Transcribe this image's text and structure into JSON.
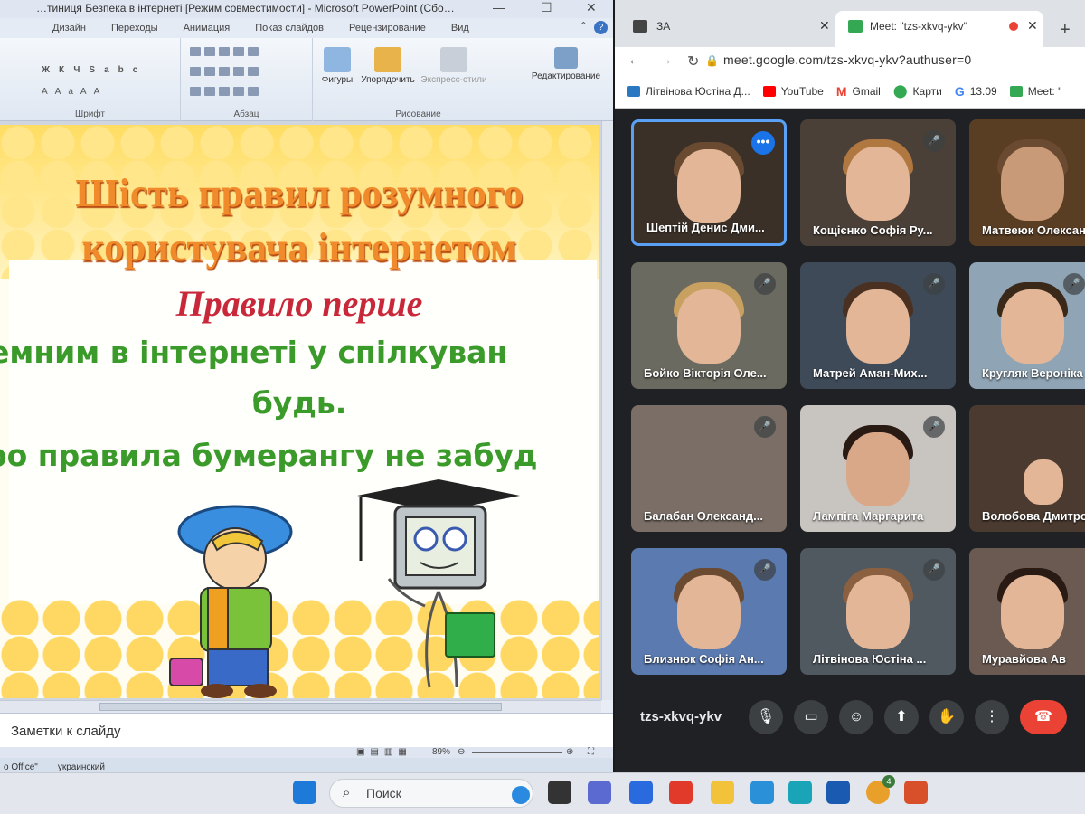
{
  "powerpoint": {
    "window_title": "…тиниця Безпека в інтернеті [Режим совместимости] - Microsoft PowerPoint (Сбо…",
    "tabs": [
      "Дизайн",
      "Переходы",
      "Анимация",
      "Показ слайдов",
      "Рецензирование",
      "Вид"
    ],
    "ribbon": {
      "groups": [
        "Шрифт",
        "Абзац",
        "Рисование"
      ],
      "shapes_label": "Фигуры",
      "arrange_label": "Упорядочить",
      "quick_styles_label": "Экспресс-стили",
      "editing_label": "Редактирование"
    },
    "slide": {
      "title_line1": "Шість правил розумного",
      "title_line2": "користувача інтернетом",
      "rule_heading": "Правило перше",
      "body_line1": "емним в інтернеті у спілкуван",
      "body_line2": "будь.",
      "body_line3": "ро правила бумерангу не забуд"
    },
    "notes_placeholder": "Заметки к слайду",
    "zoom": "89%",
    "status": {
      "theme": "о Office\"",
      "language": "украинский"
    }
  },
  "chrome": {
    "tabs": [
      {
        "label": "ЗА"
      },
      {
        "label": "Meet: \"tzs-xkvq-ykv\""
      }
    ],
    "url": "meet.google.com/tzs-xkvq-ykv?authuser=0",
    "bookmarks": [
      "Літвінова Юстіна Д...",
      "YouTube",
      "Gmail",
      "Карти",
      "13.09",
      "Meet: \""
    ]
  },
  "meet": {
    "participants": [
      "Шептій Денис Дми...",
      "Кощієнко Софія Ру...",
      "Матвеюк Олексан",
      "Бойко Вікторія Оле...",
      "Матрей Аман-Мих...",
      "Кругляк Вероніка",
      "Балабан Олександ...",
      "Лампіга Маргарита",
      "Волобова Дмитро",
      "Близнюк Софія Ан...",
      "Літвінова Юстіна ...",
      "Муравйова Ав"
    ],
    "meeting_code": "tzs-xkvq-ykv"
  },
  "taskbar": {
    "search_placeholder": "Поиск",
    "notification_badge": "4"
  }
}
